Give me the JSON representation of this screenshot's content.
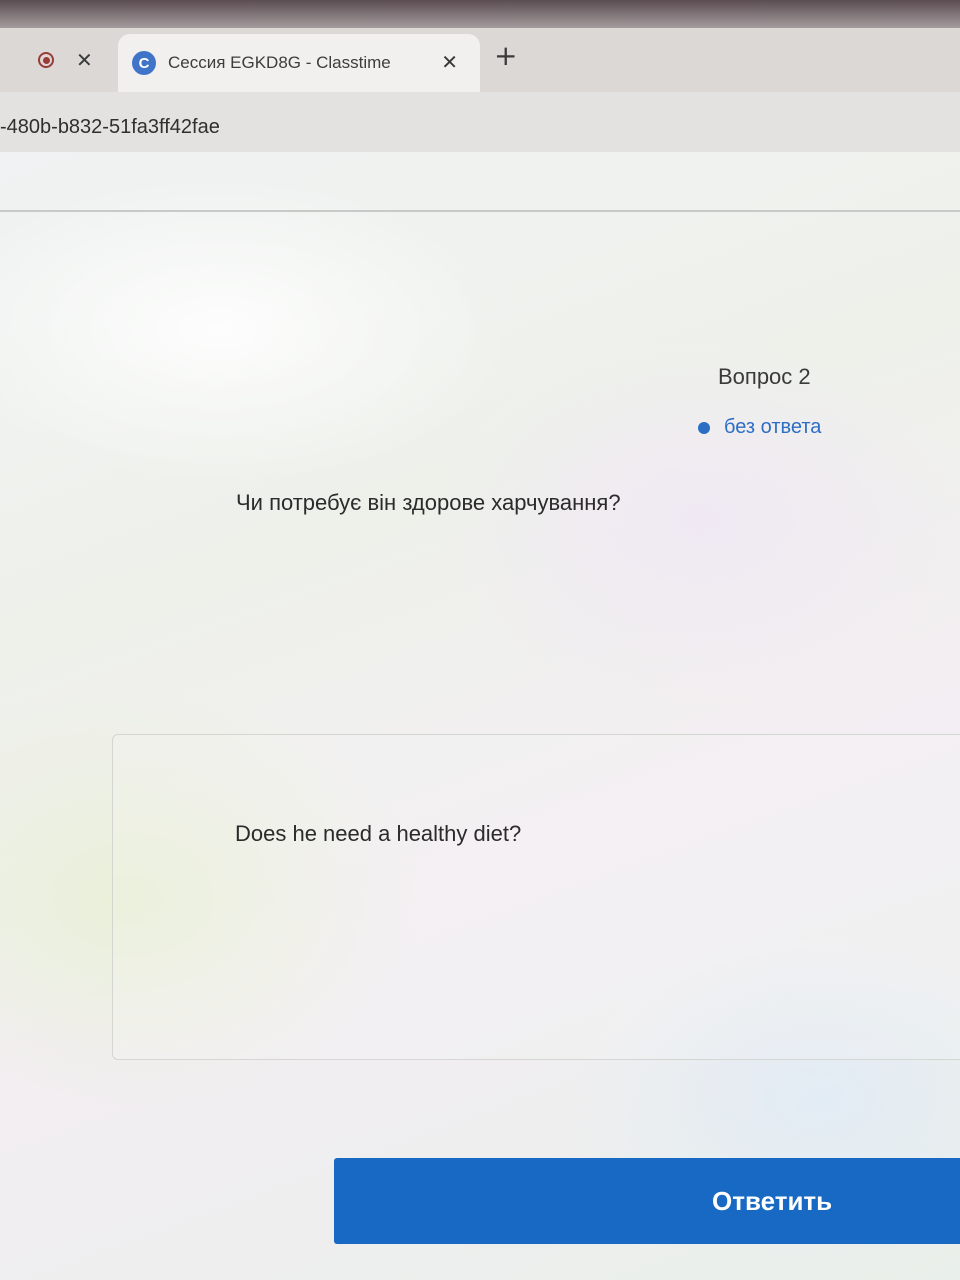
{
  "browser": {
    "tabs": [
      {
        "title": "",
        "icon": "record-icon"
      },
      {
        "title": "Сессия EGKD8G - Classtime",
        "icon": "classtime-favicon",
        "favicon_letter": "C",
        "active": true
      }
    ],
    "close_glyph": "✕",
    "new_tab_glyph": "+",
    "url": "-480b-b832-51fa3ff42fae"
  },
  "question": {
    "number_label": "Вопрос 2",
    "status_label": "без ответа",
    "status_color": "#2d6ec5",
    "text": "Чи потребує він здорове харчування?"
  },
  "answer": {
    "value": "Does he need a healthy diet?"
  },
  "actions": {
    "submit_label": "Ответить",
    "submit_color": "#1769c3"
  }
}
